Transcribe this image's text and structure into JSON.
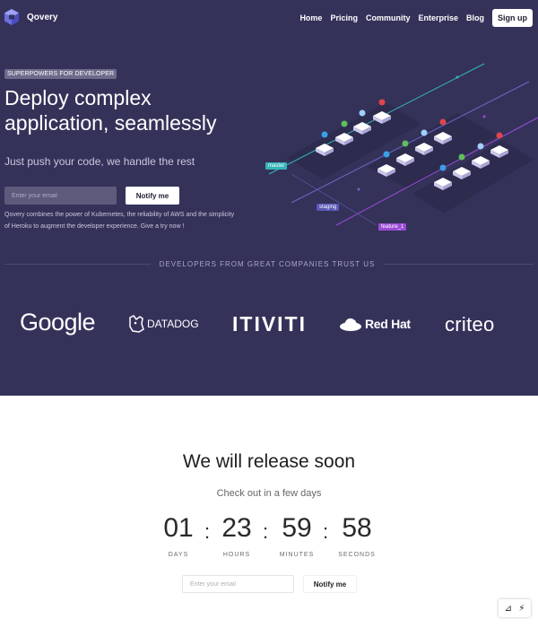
{
  "header": {
    "brand": "Qovery",
    "nav": [
      "Home",
      "Pricing",
      "Community",
      "Enterprise",
      "Blog"
    ],
    "signup": "Sign up"
  },
  "hero": {
    "tag": "SUPERPOWERS FOR DEVELOPER",
    "title": "Deploy complex application, seamlessly",
    "subtitle": "Just push your code, we handle the rest",
    "email_placeholder": "Enter your email",
    "notify": "Notify me",
    "description": "Qovery combines the power of Kubernetes, the reliability of AWS and the simplicity of Heroku to augment the developer experience. Give a try now !"
  },
  "illustration": {
    "branches": [
      "master",
      "staging",
      "feature_1"
    ]
  },
  "trusted": {
    "title": "DEVELOPERS FROM GREAT COMPANIES TRUST US",
    "companies": [
      "Google",
      "DATADOG",
      "ITIVITI",
      "Red Hat",
      "criteo"
    ]
  },
  "release": {
    "title": "We will release soon",
    "subtitle": "Check out in a few days",
    "countdown": [
      {
        "value": "01",
        "label": "DAYS"
      },
      {
        "value": "23",
        "label": "HOURS"
      },
      {
        "value": "59",
        "label": "MINUTES"
      },
      {
        "value": "58",
        "label": "SECONDS"
      }
    ],
    "separator": ":",
    "email_placeholder": "Enter your email",
    "notify": "Notify me"
  },
  "colors": {
    "hero_bg": "#35325a",
    "master": "#35b3b8",
    "staging": "#5a58b8",
    "feature": "#9a4bd6"
  },
  "icons": [
    "qovery-logo-icon",
    "datadog-dog-icon",
    "redhat-hat-icon",
    "triangle-ruler-icon",
    "lightning-icon"
  ]
}
